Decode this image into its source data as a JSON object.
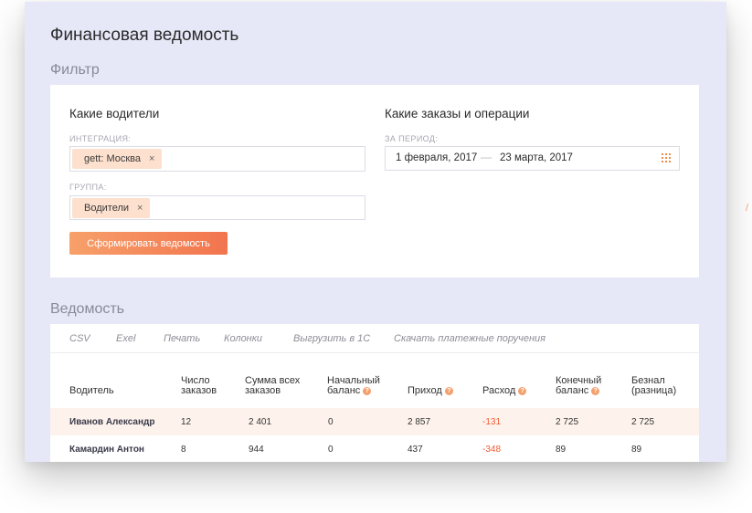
{
  "page_title": "Финансовая ведомость",
  "filter_section_title": "Фильтр",
  "report_section_title": "Ведомость",
  "drivers": {
    "title": "Какие водители",
    "integration_label": "ИНТЕГРАЦИЯ:",
    "integration_tag": "gett: Москва",
    "group_label": "ГРУППА:",
    "group_tag": "Водители",
    "tag_remove": "×"
  },
  "orders": {
    "title": "Какие заказы и операции",
    "period_label": "ЗА ПЕРИОД:",
    "date_from": "1 февраля, 2017",
    "dash": "—",
    "date_to": "23 марта, 2017"
  },
  "generate_button": "Сформировать ведомость",
  "toolbar": [
    "CSV",
    "Exel",
    "Печать",
    "Колонки",
    "Выгрузить в 1С",
    "Скачать платежные поручения"
  ],
  "table": {
    "headers": [
      {
        "line1": "Водитель",
        "line2": ""
      },
      {
        "line1": "Число",
        "line2": "заказов"
      },
      {
        "line1": "Сумма всех",
        "line2": "заказов"
      },
      {
        "line1": "Начальный",
        "line2": "баланс"
      },
      {
        "line1": "Приход",
        "line2": ""
      },
      {
        "line1": "Расход",
        "line2": ""
      },
      {
        "line1": "Конечный",
        "line2": "баланс"
      },
      {
        "line1": "Безнал",
        "line2": "(разница)"
      }
    ],
    "help_mark": "?",
    "rows": [
      {
        "name": "Иванов Александр",
        "orders": "12",
        "sum": "2 401",
        "start": "0",
        "income": "2 857",
        "expense": "-131",
        "end": "2 725",
        "cashless": "2 725"
      },
      {
        "name": "Камардин Антон",
        "orders": "8",
        "sum": "944",
        "start": "0",
        "income": "437",
        "expense": "-348",
        "end": "89",
        "cashless": "89"
      }
    ]
  },
  "colors": {
    "accent": "#f2744e",
    "background": "#e6e8f8",
    "tag": "#fde0cd",
    "negative": "#ef5a35"
  }
}
